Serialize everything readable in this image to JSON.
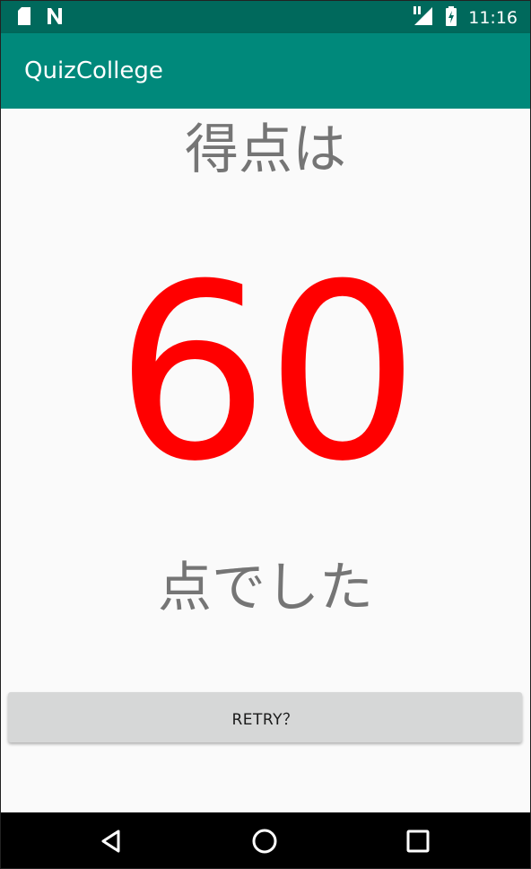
{
  "status_bar": {
    "time": "11:16",
    "icons": [
      "sd-card-icon",
      "n-notification-icon",
      "signal-icon",
      "battery-icon"
    ]
  },
  "app_bar": {
    "title": "QuizCollege"
  },
  "result": {
    "heading": "得点は",
    "score": "60",
    "suffix": "点でした"
  },
  "actions": {
    "retry_label": "RETRY？"
  },
  "nav_bar": {
    "buttons": [
      "back-icon",
      "home-icon",
      "recents-icon"
    ]
  },
  "colors": {
    "status_bar": "#00695c",
    "app_bar": "#00897b",
    "score": "#ff0000",
    "label_text": "#757575",
    "button_bg": "#d6d7d7"
  }
}
